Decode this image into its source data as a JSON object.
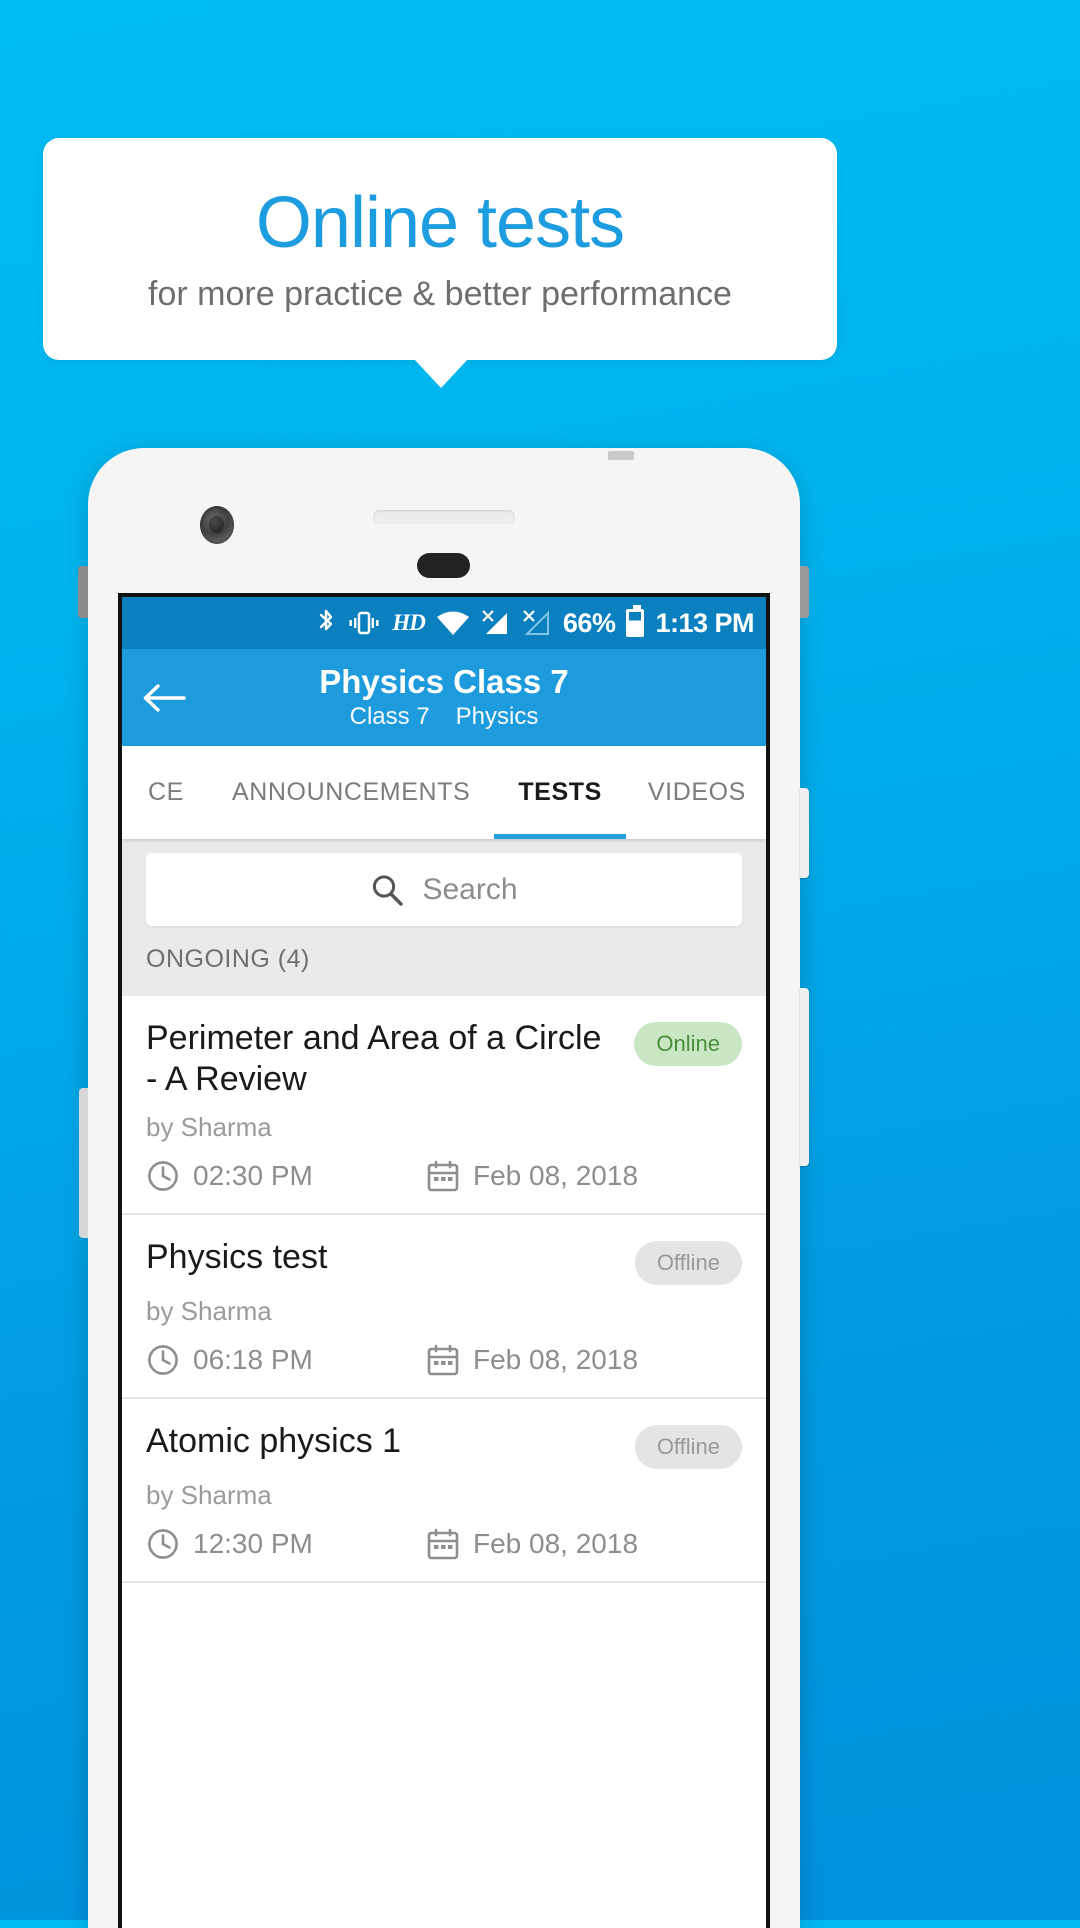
{
  "promo": {
    "headline": "Online tests",
    "subhead": "for more practice & better performance",
    "headline_color": "#1E9CE0",
    "background_color": "#00B4EE"
  },
  "status_bar": {
    "icons": [
      "bluetooth-icon",
      "vibrate-icon",
      "hd-icon",
      "wifi-icon",
      "signal-no-sim-1-icon",
      "signal-no-sim-2-icon",
      "battery-icon"
    ],
    "hd_label": "HD",
    "battery_percent": "66%",
    "time": "1:13 PM",
    "background_color": "#0B80BF"
  },
  "toolbar": {
    "back_icon": "back-arrow-icon",
    "title": "Physics Class 7",
    "subtitle_class": "Class 7",
    "subtitle_subject": "Physics",
    "background_color": "#1D9BDC"
  },
  "tabs": {
    "items": [
      {
        "label": "CE",
        "active": false
      },
      {
        "label": "ANNOUNCEMENTS",
        "active": false
      },
      {
        "label": "TESTS",
        "active": true
      },
      {
        "label": "VIDEOS",
        "active": false
      }
    ],
    "indicator_color": "#23A0DE"
  },
  "search": {
    "icon": "search-icon",
    "placeholder": "Search",
    "value": ""
  },
  "section": {
    "label": "ONGOING (4)",
    "count": 4
  },
  "tests": [
    {
      "title": "Perimeter and Area of a Circle - A Review",
      "author": "by Sharma",
      "status": "Online",
      "status_type": "online",
      "time": "02:30 PM",
      "date": "Feb 08, 2018",
      "clock_icon": "clock-icon",
      "calendar_icon": "calendar-icon"
    },
    {
      "title": "Physics test",
      "author": "by Sharma",
      "status": "Offline",
      "status_type": "offline",
      "time": "06:18 PM",
      "date": "Feb 08, 2018",
      "clock_icon": "clock-icon",
      "calendar_icon": "calendar-icon"
    },
    {
      "title": "Atomic physics 1",
      "author": "by Sharma",
      "status": "Offline",
      "status_type": "offline",
      "time": "12:30 PM",
      "date": "Feb 08, 2018",
      "clock_icon": "clock-icon",
      "calendar_icon": "calendar-icon"
    }
  ]
}
